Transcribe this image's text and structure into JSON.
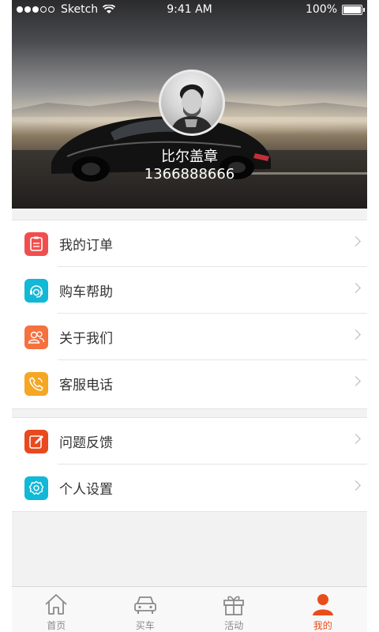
{
  "status_bar": {
    "carrier": "Sketch",
    "time": "9:41 AM",
    "battery": "100%"
  },
  "profile": {
    "name": "比尔盖章",
    "phone": "1366888666"
  },
  "menu_group_1": [
    {
      "label": "我的订单",
      "icon": "order-icon",
      "color": "#f04e4e"
    },
    {
      "label": "购车帮助",
      "icon": "customer-service-icon",
      "color": "#12b8d6"
    },
    {
      "label": "关于我们",
      "icon": "people-icon",
      "color": "#f5723f"
    },
    {
      "label": "客服电话",
      "icon": "phone-icon",
      "color": "#f5a623"
    }
  ],
  "menu_group_2": [
    {
      "label": "问题反馈",
      "icon": "edit-icon",
      "color": "#e8491d"
    },
    {
      "label": "个人设置",
      "icon": "settings-icon",
      "color": "#12b8d6"
    }
  ],
  "tabbar": {
    "items": [
      {
        "label": "首页",
        "icon": "home-icon"
      },
      {
        "label": "买车",
        "icon": "car-icon"
      },
      {
        "label": "活动",
        "icon": "gift-icon"
      },
      {
        "label": "我的",
        "icon": "user-icon",
        "active": true
      }
    ],
    "active_color": "#e84e1b",
    "inactive_color": "#8a8a8a"
  }
}
